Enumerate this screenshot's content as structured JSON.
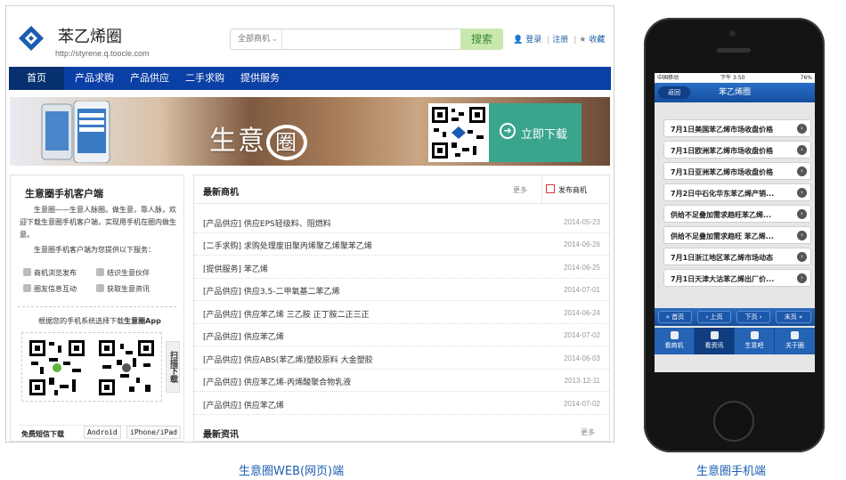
{
  "web": {
    "site_name": "苯乙烯圈",
    "site_url": "http://styrene.q.toocle.com",
    "search": {
      "category": "全部商机",
      "placeholder": "",
      "button": "搜索"
    },
    "user_links": {
      "login": "登录",
      "register": "注册",
      "favorite": "收藏"
    },
    "nav": [
      "首页",
      "产品求购",
      "产品供应",
      "二手求购",
      "提供服务"
    ],
    "banner": {
      "title_left": "生意",
      "title_ring": "圈",
      "download": "立即下载"
    },
    "left": {
      "title": "生意圈手机客户端",
      "desc": "生意圈——生意人脉圈。做生意，靠人脉，欢迎下载生意圈手机客户端，实现用手机在圈内做生意。",
      "features_header": "生意圈手机客户端为您提供以下服务：",
      "features": [
        "商机浏览发布",
        "结识生意伙伴",
        "圈友信息互动",
        "获取生意资讯"
      ],
      "system_prompt_pre": "根据您的手机系统选择下载",
      "system_prompt_app": "生意圈App",
      "scan_tab": "扫描下载",
      "tabs": [
        "免费短信下载",
        "Android",
        "iPhone/iPad"
      ]
    },
    "center": {
      "title": "最新商机",
      "more": "更多",
      "post": "发布商机",
      "rows": [
        {
          "text": "[产品供应] 供应EPS轻级料、阻燃料",
          "date": "2014-05-23"
        },
        {
          "text": "[二手求购] 求购处理废旧聚丙烯聚乙烯聚苯乙烯",
          "date": "2014-06-26"
        },
        {
          "text": "[提供服务] 苯乙烯",
          "date": "2014-06-25"
        },
        {
          "text": "[产品供应] 供应3,5-二甲氧基二苯乙烯",
          "date": "2014-07-01"
        },
        {
          "text": "[产品供应] 供应苯乙烯 三乙胺 正丁胺二正三正",
          "date": "2014-06-24"
        },
        {
          "text": "[产品供应] 供应苯乙烯",
          "date": "2014-07-02"
        },
        {
          "text": "[产品供应] 供应ABS(苯乙烯)塑胶原料 大金塑胶",
          "date": "2014-06-03"
        },
        {
          "text": "[产品供应] 供应苯乙烯-丙烯酸聚合物乳液",
          "date": "2013-12-11"
        },
        {
          "text": "[产品供应] 供应苯乙烯",
          "date": "2014-07-02"
        }
      ],
      "sub_title": "最新资讯",
      "sub_more": "更多"
    }
  },
  "phone": {
    "status": {
      "carrier": "中国移动",
      "time": "下午 3:50",
      "battery": "76%"
    },
    "back": "返回",
    "title": "苯乙烯圈",
    "items": [
      "7月1日美国苯乙烯市场收盘价格",
      "7月1日欧洲苯乙烯市场收盘价格",
      "7月1日亚洲苯乙烯市场收盘价格",
      "7月2日中石化华东苯乙烯产销...",
      "供给不足叠加需求趋旺苯乙烯...",
      "供给不足叠加需求趋旺 苯乙烯...",
      "7月1日浙江地区苯乙烯市场动态",
      "7月1日天津大沽苯乙烯出厂价..."
    ],
    "pager": [
      "首页",
      "上页",
      "下页",
      "末页"
    ],
    "tabs": [
      "看商机",
      "看资讯",
      "生意吧",
      "关于圈"
    ]
  },
  "captions": {
    "web": "生意圈WEB(网页)端",
    "mobile": "生意圈手机端"
  },
  "colors": {
    "nav": "#0a3fa5",
    "search_btn": "#c8e8b0",
    "link": "#1f5ea8",
    "caption": "#1e5fb1"
  }
}
